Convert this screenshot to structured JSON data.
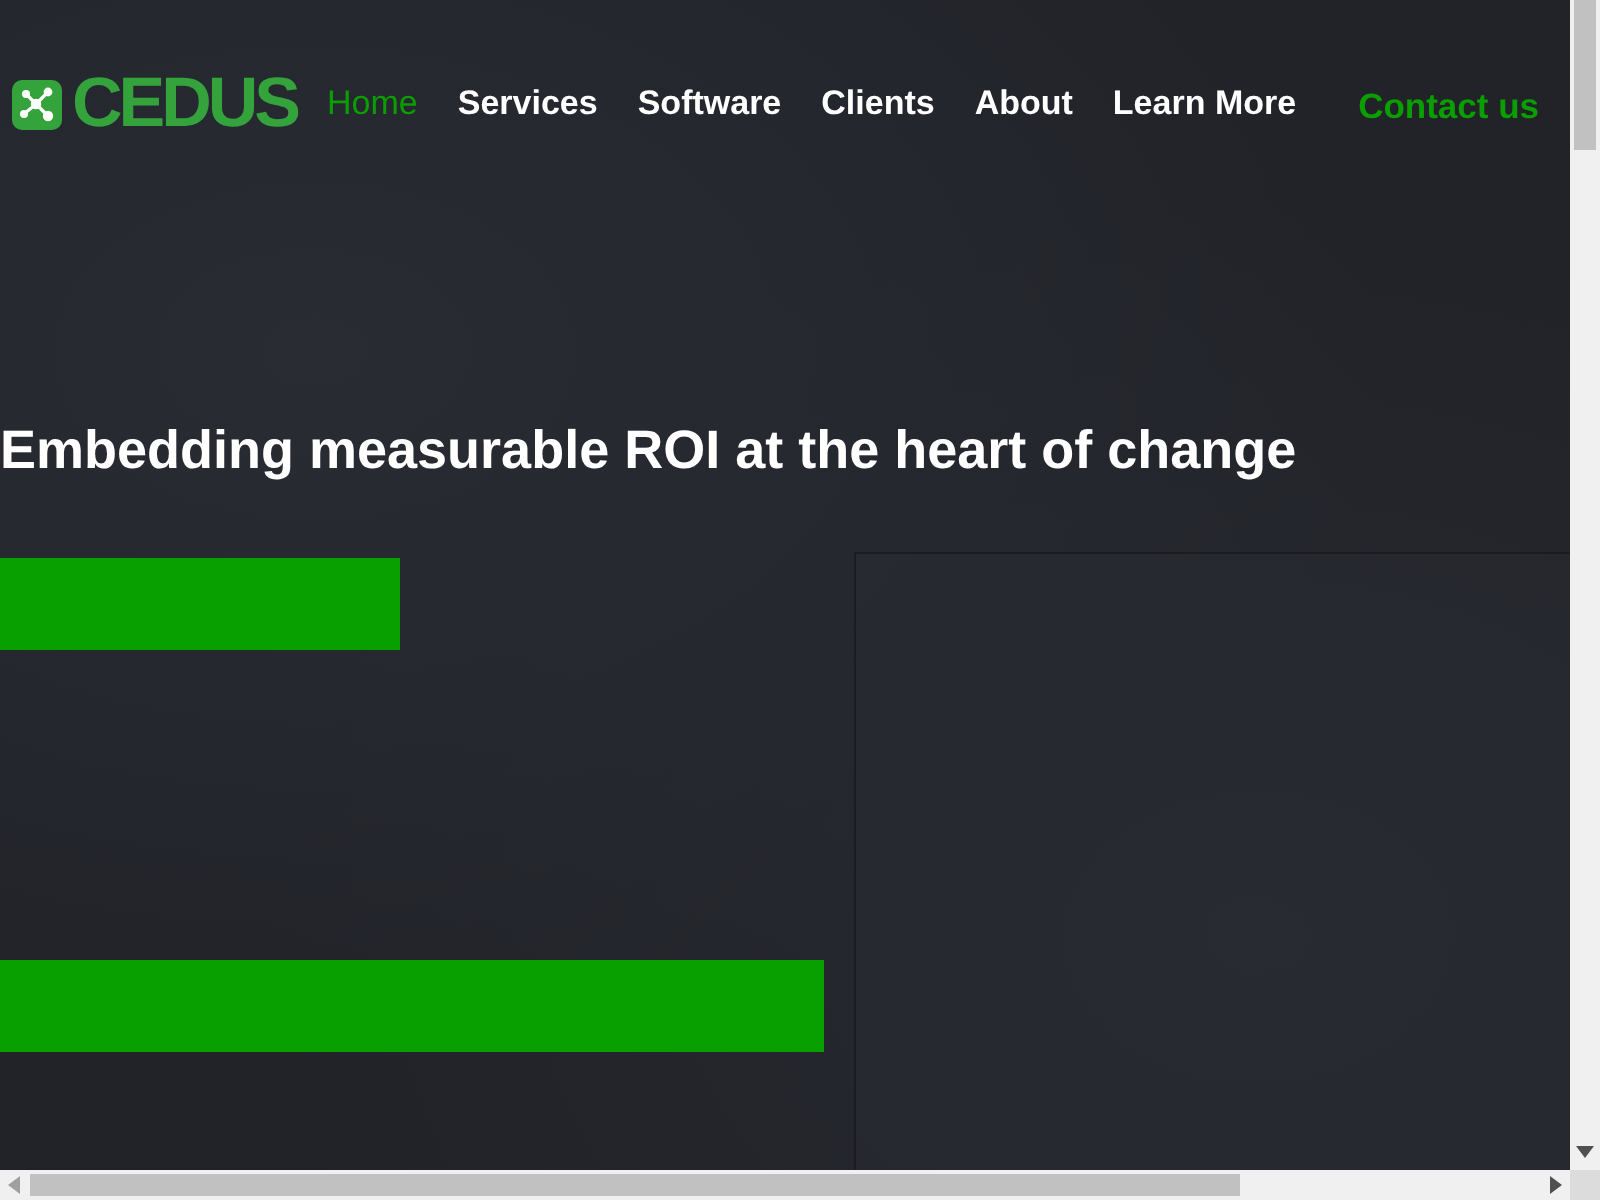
{
  "logo": {
    "text": "CEDUS"
  },
  "nav": {
    "items": [
      {
        "label": "Home",
        "selected": true,
        "kind": "link"
      },
      {
        "label": "Services",
        "selected": false,
        "kind": "link"
      },
      {
        "label": "Software",
        "selected": false,
        "kind": "link"
      },
      {
        "label": "Clients",
        "selected": false,
        "kind": "link"
      },
      {
        "label": "About",
        "selected": false,
        "kind": "link"
      },
      {
        "label": "Learn More",
        "selected": false,
        "kind": "link"
      },
      {
        "label": "Contact us",
        "selected": false,
        "kind": "cta"
      }
    ]
  },
  "hero": {
    "heading": "Embedding measurable ROI at the heart of change",
    "bars": [
      {
        "kind": "short"
      },
      {
        "kind": "long"
      }
    ]
  }
}
